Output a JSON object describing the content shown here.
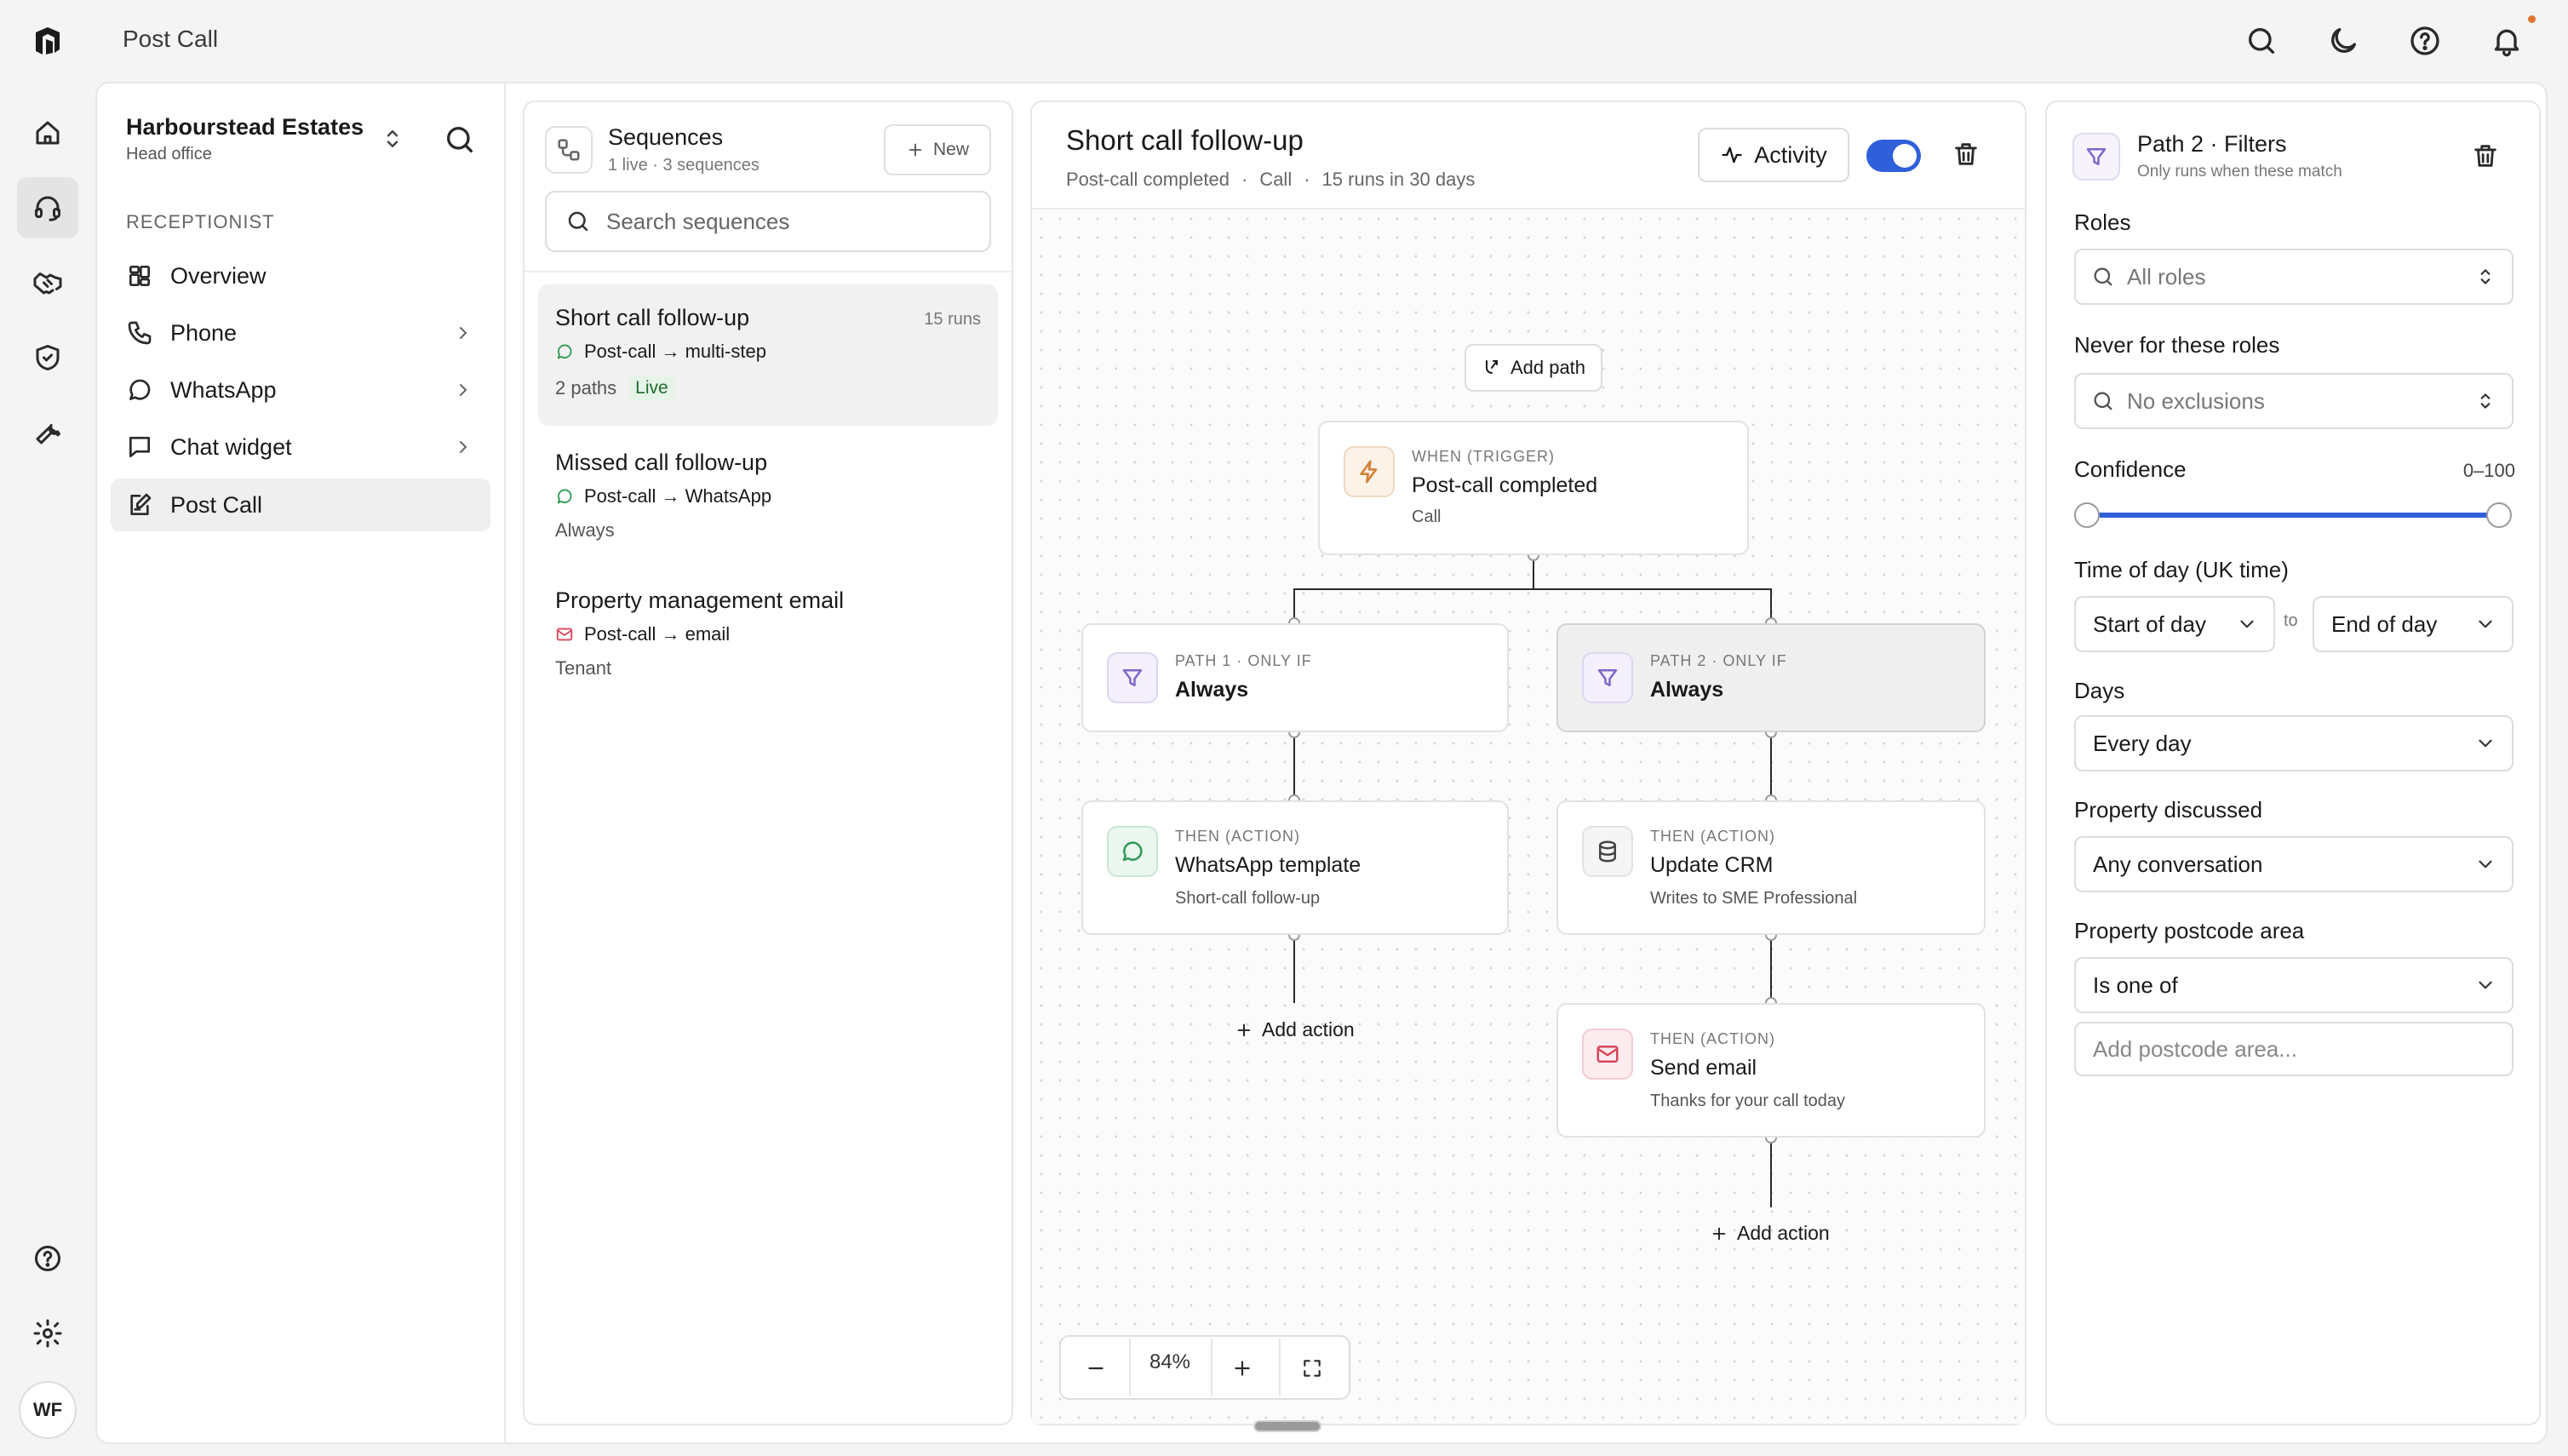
{
  "app": {
    "title": "Post Call"
  },
  "org": {
    "name": "Harbourstead Estates",
    "subtitle": "Head office"
  },
  "user": {
    "initials": "WF"
  },
  "rail": {
    "icons": [
      "home-icon",
      "headset-icon",
      "handshake-icon",
      "shield-icon",
      "wrench-icon",
      "help-icon",
      "settings-icon"
    ]
  },
  "nav": {
    "section": "RECEPTIONIST",
    "items": [
      {
        "label": "Overview",
        "icon": "grid-icon"
      },
      {
        "label": "Phone",
        "icon": "phone-icon"
      },
      {
        "label": "WhatsApp",
        "icon": "chat-icon"
      },
      {
        "label": "Chat widget",
        "icon": "message-square-icon"
      },
      {
        "label": "Post Call",
        "icon": "edit-note-icon"
      }
    ]
  },
  "sequences": {
    "title": "Sequences",
    "subtitle": "1 live · 3 sequences",
    "new_label": "New",
    "search_placeholder": "Search sequences",
    "items": [
      {
        "name": "Short call follow-up",
        "runs": "15 runs",
        "path": "Post-call → multi-step",
        "meta": "2 paths",
        "badge": "Live",
        "channel": "whatsapp"
      },
      {
        "name": "Missed call follow-up",
        "path": "Post-call → WhatsApp",
        "meta": "Always",
        "channel": "whatsapp"
      },
      {
        "name": "Property management email",
        "path": "Post-call → email",
        "meta": "Tenant",
        "channel": "email"
      }
    ]
  },
  "canvas": {
    "title": "Short call follow-up",
    "meta": [
      "Post-call completed",
      "·",
      "Call",
      "·",
      "15 runs in 30 days"
    ],
    "activity_label": "Activity",
    "enabled": true,
    "add_path_label": "Add path",
    "trigger": {
      "kicker": "WHEN (TRIGGER)",
      "title": "Post-call completed",
      "sub": "Call"
    },
    "paths": [
      {
        "kicker": "PATH 1 · ONLY IF",
        "condition": "Always",
        "actions": [
          {
            "kicker": "THEN (ACTION)",
            "title": "WhatsApp template",
            "sub": "Short-call follow-up"
          }
        ],
        "add_action_label": "Add action"
      },
      {
        "kicker": "PATH 2 · ONLY IF",
        "condition": "Always",
        "actions": [
          {
            "kicker": "THEN (ACTION)",
            "title": "Update CRM",
            "sub": "Writes to SME Professional"
          },
          {
            "kicker": "THEN (ACTION)",
            "title": "Send email",
            "sub": "Thanks for your call today"
          }
        ],
        "add_action_label": "Add action"
      }
    ],
    "zoom": "84%"
  },
  "filters": {
    "title": "Path 2 · Filters",
    "subtitle": "Only runs when these match",
    "roles": {
      "label": "Roles",
      "value": "All roles"
    },
    "never_roles": {
      "label": "Never for these roles",
      "value": "No exclusions"
    },
    "confidence": {
      "label": "Confidence",
      "range_text": "0–100",
      "min": 0,
      "max": 100
    },
    "time_of_day": {
      "label": "Time of day (UK time)",
      "start": "Start of day",
      "to": "to",
      "end": "End of day"
    },
    "days": {
      "label": "Days",
      "value": "Every day"
    },
    "property_discussed": {
      "label": "Property discussed",
      "value": "Any conversation"
    },
    "postcode": {
      "label": "Property postcode area",
      "operator": "Is one of",
      "placeholder": "Add postcode area..."
    }
  },
  "colors": {
    "accent": "#2f5fd9",
    "live_green": "#1f6b2c",
    "trigger_orange": "#d0843a",
    "filter_purple": "#7d68c9",
    "whatsapp_green": "#2e9a55",
    "email_red": "#d8455a"
  }
}
